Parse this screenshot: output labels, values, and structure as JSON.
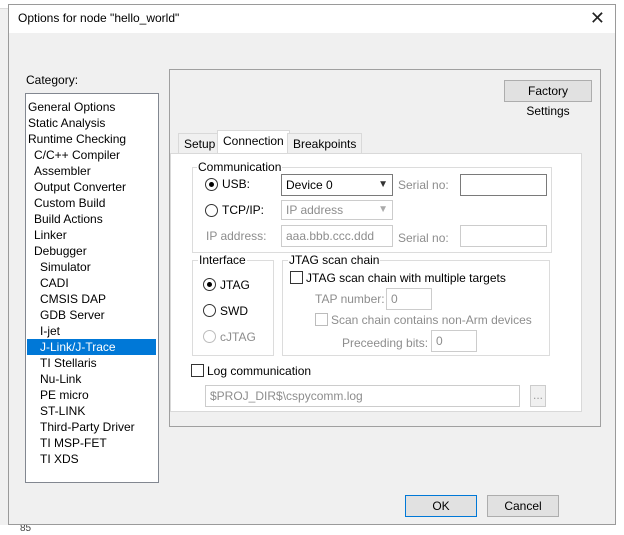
{
  "window": {
    "title": "Options for node \"hello_world\"",
    "close_glyph": "✕"
  },
  "background": {
    "line_number": "85"
  },
  "category": {
    "label": "Category:",
    "items": [
      {
        "label": "General Options",
        "level": 0
      },
      {
        "label": "Static Analysis",
        "level": 0
      },
      {
        "label": "Runtime Checking",
        "level": 0
      },
      {
        "label": "C/C++ Compiler",
        "level": 1
      },
      {
        "label": "Assembler",
        "level": 1
      },
      {
        "label": "Output Converter",
        "level": 1
      },
      {
        "label": "Custom Build",
        "level": 1
      },
      {
        "label": "Build Actions",
        "level": 1
      },
      {
        "label": "Linker",
        "level": 1
      },
      {
        "label": "Debugger",
        "level": 1
      },
      {
        "label": "Simulator",
        "level": 2
      },
      {
        "label": "CADI",
        "level": 2
      },
      {
        "label": "CMSIS DAP",
        "level": 2
      },
      {
        "label": "GDB Server",
        "level": 2
      },
      {
        "label": "I-jet",
        "level": 2
      },
      {
        "label": "J-Link/J-Trace",
        "level": 2,
        "selected": true
      },
      {
        "label": "TI Stellaris",
        "level": 2
      },
      {
        "label": "Nu-Link",
        "level": 2
      },
      {
        "label": "PE micro",
        "level": 2
      },
      {
        "label": "ST-LINK",
        "level": 2
      },
      {
        "label": "Third-Party Driver",
        "level": 2
      },
      {
        "label": "TI MSP-FET",
        "level": 2
      },
      {
        "label": "TI XDS",
        "level": 2
      }
    ]
  },
  "factory_settings": "Factory Settings",
  "tabs": [
    {
      "label": "Setup"
    },
    {
      "label": "Connection",
      "active": true
    },
    {
      "label": "Breakpoints"
    }
  ],
  "communication": {
    "title": "Communication",
    "usb_label": "USB:",
    "usb_device": "Device 0",
    "serial_label": "Serial no:",
    "serial_value": "",
    "tcpip_label": "TCP/IP:",
    "tcpip_value": "IP address",
    "ip_label": "IP address:",
    "ip_value": "aaa.bbb.ccc.ddd",
    "serial2_label": "Serial no:",
    "serial2_value": ""
  },
  "interface": {
    "title": "Interface",
    "jtag": "JTAG",
    "swd": "SWD",
    "cjtag": "cJTAG"
  },
  "jtag_chain": {
    "title": "JTAG scan chain",
    "multi_targets": "JTAG scan chain with multiple targets",
    "tap_label": "TAP number:",
    "tap_value": "0",
    "non_arm": "Scan chain contains non-Arm devices",
    "preceding_label": "Preceeding bits:",
    "preceding_value": "0"
  },
  "log": {
    "label": "Log communication",
    "path": "$PROJ_DIR$\\cspycomm.log",
    "browse": "..."
  },
  "buttons": {
    "ok": "OK",
    "cancel": "Cancel"
  }
}
